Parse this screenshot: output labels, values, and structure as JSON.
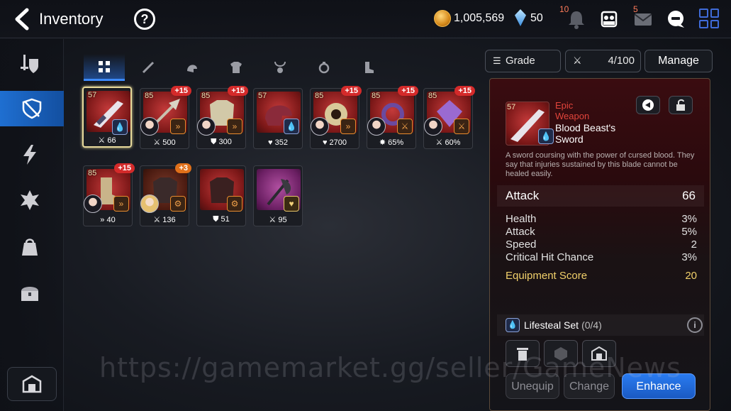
{
  "header": {
    "title": "Inventory",
    "help_label": "?",
    "gold": "1,005,569",
    "crystals": "50",
    "notifications_badge": "10",
    "mail_badge": "5"
  },
  "sidebar": {
    "items": [
      {
        "icon": "sword-shield-icon",
        "active": false
      },
      {
        "icon": "shield-slash-icon",
        "active": true
      },
      {
        "icon": "lightning-icon",
        "active": false
      },
      {
        "icon": "artifact-icon",
        "active": false
      },
      {
        "icon": "bag-icon",
        "active": false
      },
      {
        "icon": "chest-icon",
        "active": false
      }
    ]
  },
  "tabs": [
    {
      "icon": "grid-icon",
      "active": true
    },
    {
      "icon": "sword-icon",
      "active": false
    },
    {
      "icon": "helmet-icon",
      "active": false
    },
    {
      "icon": "armor-icon",
      "active": false
    },
    {
      "icon": "necklace-icon",
      "active": false
    },
    {
      "icon": "ring-icon",
      "active": false
    },
    {
      "icon": "boots-icon",
      "active": false
    }
  ],
  "controls": {
    "grade_label": "Grade",
    "storage_count": "4/100",
    "manage_label": "Manage"
  },
  "items": [
    {
      "level": "57",
      "plus": "",
      "stat": "66",
      "selected": true
    },
    {
      "level": "85",
      "plus": "+15",
      "stat": "500"
    },
    {
      "level": "85",
      "plus": "+15",
      "stat": "300"
    },
    {
      "level": "57",
      "plus": "",
      "stat": "352"
    },
    {
      "level": "85",
      "plus": "+15",
      "stat": "2700"
    },
    {
      "level": "85",
      "plus": "+15",
      "stat": "65%"
    },
    {
      "level": "85",
      "plus": "+15",
      "stat": "60%"
    },
    {
      "level": "85",
      "plus": "+15",
      "stat": "40"
    },
    {
      "level": "",
      "plus": "+3",
      "stat": "136"
    },
    {
      "level": "",
      "plus": "",
      "stat": "51"
    },
    {
      "level": "",
      "plus": "",
      "stat": "95"
    }
  ],
  "detail": {
    "level": "57",
    "grade": "Epic",
    "type": "Weapon",
    "name": "Blood Beast's Sword",
    "description": "A sword coursing with the power of cursed blood. They say that injuries sustained by this blade cannot be healed easily.",
    "main_stat": {
      "label": "Attack",
      "value": "66"
    },
    "substats": [
      {
        "label": "Health",
        "value": "3%"
      },
      {
        "label": "Attack",
        "value": "5%"
      },
      {
        "label": "Speed",
        "value": "2"
      },
      {
        "label": "Critical Hit Chance",
        "value": "3%"
      }
    ],
    "score": {
      "label": "Equipment Score",
      "value": "20"
    },
    "set_name": "Lifesteal Set",
    "set_count": "(0/4)",
    "info_label": "i",
    "unequip_label": "Unequip",
    "change_label": "Change",
    "enhance_label": "Enhance"
  },
  "watermark": "https://gamemarket.gg/seller/GameNews",
  "colors": {
    "accent_blue": "#1f6fd1",
    "epic_red": "#e2443b",
    "score_gold": "#f1d06a",
    "plus_badge": "#d42a2a"
  }
}
